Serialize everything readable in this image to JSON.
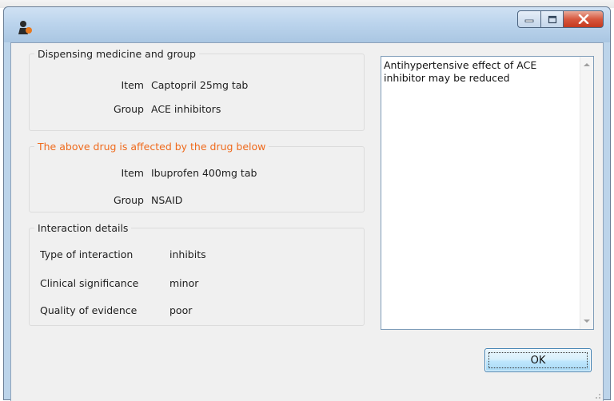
{
  "window": {
    "title": ""
  },
  "dispensing": {
    "legend": "Dispensing medicine and group",
    "item_label": "Item",
    "item_value": "Captopril 25mg tab",
    "group_label": "Group",
    "group_value": "ACE inhibitors"
  },
  "affected": {
    "legend": "The above drug is affected by the drug below",
    "legend_color": "#ef6a1c",
    "item_label": "Item",
    "item_value": "Ibuprofen 400mg tab",
    "group_label": "Group",
    "group_value": "NSAID"
  },
  "interaction": {
    "legend": "Interaction details",
    "type_label": "Type of interaction",
    "type_value": "inhibits",
    "significance_label": "Clinical significance",
    "significance_value": "minor",
    "evidence_label": "Quality of evidence",
    "evidence_value": "poor"
  },
  "notes": {
    "text": "Antihypertensive effect of ACE inhibitor may be reduced"
  },
  "buttons": {
    "ok_label": "OK"
  },
  "icons": {
    "app": "app-icon",
    "minimize": "minimize-icon",
    "maximize": "maximize-icon",
    "close": "close-icon"
  }
}
